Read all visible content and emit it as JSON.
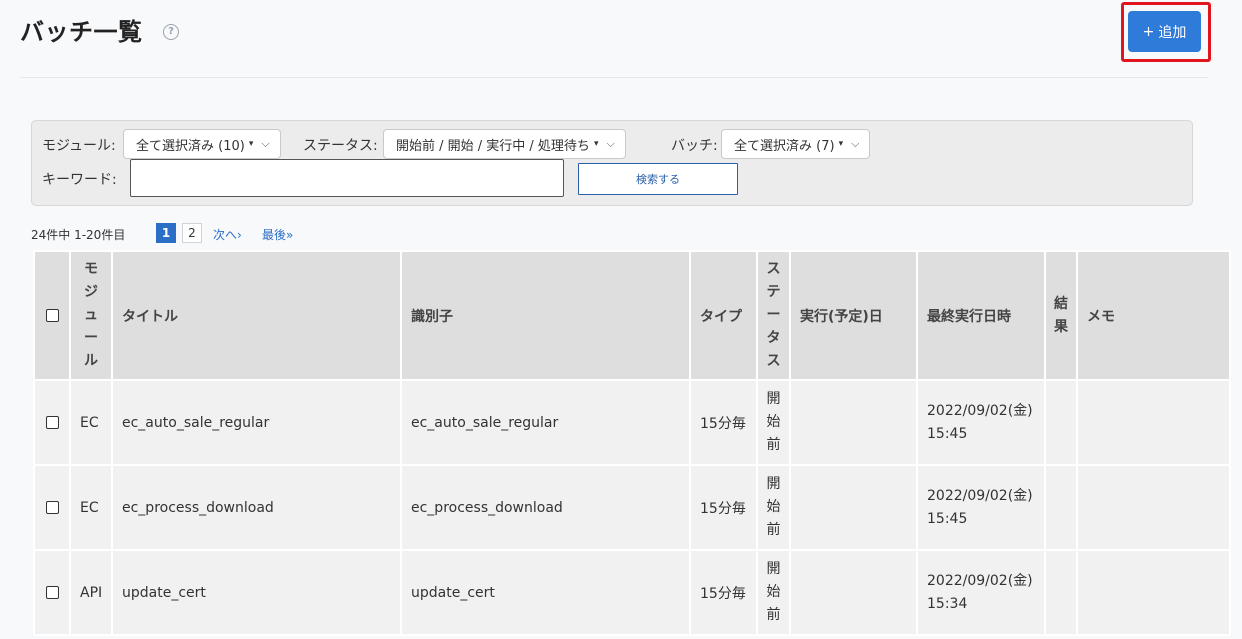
{
  "header": {
    "title": "バッチ一覧",
    "help_icon": "question-circle",
    "add_button": {
      "icon": "+",
      "label": "追加"
    }
  },
  "filters": {
    "module_label": "モジュール:",
    "module_value": "全て選択済み (10)",
    "status_label": "ステータス:",
    "status_value": "開始前 / 開始 / 実行中 / 処理待ち",
    "batch_label": "バッチ:",
    "batch_value": "全て選択済み (7)",
    "keyword_label": "キーワード:",
    "keyword_value": "",
    "search_button": "検索する",
    "caret_icon": "▾",
    "chevron_icon": "⌄"
  },
  "pagination": {
    "summary": "24件中 1-20件目",
    "pages": [
      "1",
      "2"
    ],
    "current_page": "1",
    "next": "次へ›",
    "last": "最後»"
  },
  "table": {
    "columns": [
      "モジュール",
      "タイトル",
      "識別子",
      "タイプ",
      "ステータス",
      "実行(予定)日",
      "最終実行日時",
      "結果",
      "メモ"
    ],
    "rows": [
      {
        "module": "EC",
        "title": "ec_auto_sale_regular",
        "identifier": "ec_auto_sale_regular",
        "type": "15分毎",
        "status": "開始前",
        "scheduled": "",
        "last_run_date": "2022/09/02(金)",
        "last_run_time": "15:45",
        "result": "",
        "memo": ""
      },
      {
        "module": "EC",
        "title": "ec_process_download",
        "identifier": "ec_process_download",
        "type": "15分毎",
        "status": "開始前",
        "scheduled": "",
        "last_run_date": "2022/09/02(金)",
        "last_run_time": "15:45",
        "result": "",
        "memo": ""
      },
      {
        "module": "API",
        "title": "update_cert",
        "identifier": "update_cert",
        "type": "15分毎",
        "status": "開始前",
        "scheduled": "",
        "last_run_date": "2022/09/02(金)",
        "last_run_time": "15:34",
        "result": "",
        "memo": ""
      }
    ]
  },
  "colors": {
    "primary": "#2e7bd9",
    "highlight": "#e0151d",
    "link": "#2a6ec6"
  }
}
